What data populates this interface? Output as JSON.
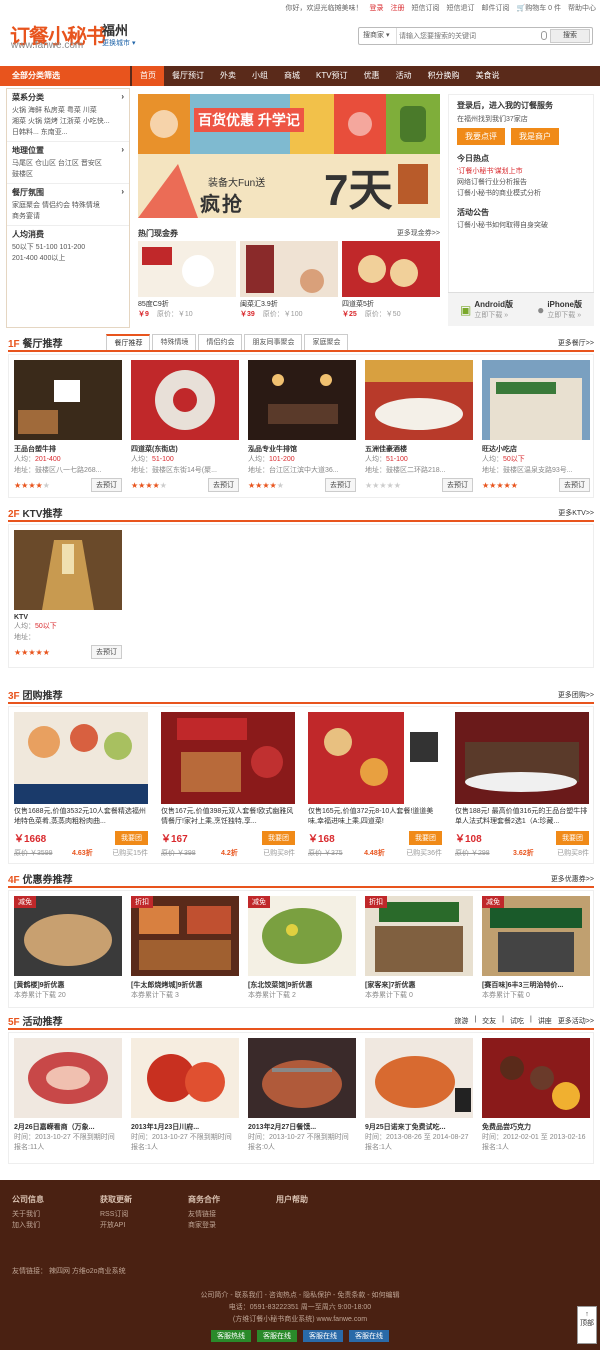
{
  "topbar": {
    "greeting": "你好，欢迎光临摊美味！",
    "login": "登录",
    "register": "注册",
    "links": [
      "短信订阅",
      "短信退订",
      "邮件订阅"
    ],
    "cart": "购物车 0 件",
    "help": "帮助中心"
  },
  "header": {
    "logo": "订餐小秘书",
    "logo_url": "www.fanwe.com",
    "city": "福州",
    "city_switch": "更换城市",
    "search_type": "搜商家",
    "search_placeholder": "请输入您要搜索的关键词",
    "search_button": "搜索"
  },
  "nav": {
    "all_categories": "全部分类筛选",
    "items": [
      "首页",
      "餐厅预订",
      "外卖",
      "小组",
      "商城",
      "KTV预订",
      "优惠",
      "活动",
      "积分换购",
      "美食说"
    ]
  },
  "sidebar": {
    "sections": [
      {
        "title": "菜系分类",
        "links": "201-400"
      },
      {
        "title": "地理位置"
      },
      {
        "title": "餐厅氛围"
      },
      {
        "title": "人均消费"
      }
    ],
    "cuisine": [
      "火锅",
      "海鲜",
      "私房菜",
      "粤菜",
      "川菜",
      "湘菜",
      "火锅",
      "烧烤",
      "江浙菜",
      "小吃快...",
      "日韩料...",
      "东南亚..."
    ],
    "location": [
      "马尾区",
      "仓山区",
      "台江区",
      "晋安区",
      "鼓楼区"
    ],
    "ambience": [
      "家庭聚会",
      "情侣约会",
      "特殊情境",
      "商务宴请"
    ],
    "price": [
      "50以下",
      "51-100",
      "101-200",
      "201-400",
      "400以上"
    ]
  },
  "banner": {
    "title": "百货优惠 升学记",
    "line1": "装备大Fun送",
    "line2": "疯抢",
    "seven": "7天"
  },
  "coupons": {
    "title": "热门现金券",
    "more": "更多现金券>>",
    "items": [
      {
        "name": "85度C9折",
        "price": "￥9",
        "orig": "原价：￥10"
      },
      {
        "name": "闽菜汇3.9折",
        "price": "￥39",
        "orig": "原价：￥100"
      },
      {
        "name": "四道菜5折",
        "price": "￥25",
        "orig": "原价：￥50"
      }
    ]
  },
  "right": {
    "login_title": "登录后，进入我的订餐服务",
    "sub": "在福州找到我们37家店",
    "btn1": "我要点评",
    "btn2": "我是商户",
    "hot_title": "今日热点",
    "hot": [
      "'订餐小秘书'谋划上市",
      "网络订餐行业分析报告",
      "订餐小秘书的商业模式分析"
    ],
    "notice_title": "活动公告",
    "notice": [
      "订餐小秘书如何取得自身突破"
    ],
    "android": "Android版",
    "android_sub": "立即下载 »",
    "iphone": "iPhone版",
    "iphone_sub": "立即下载 »"
  },
  "f1": {
    "num": "1F",
    "title": "餐厅推荐",
    "tabs": [
      "餐厅推荐",
      "特殊情境",
      "情侣约会",
      "朋友同事聚会",
      "家庭聚会"
    ],
    "more": "更多餐厅>>",
    "cards": [
      {
        "name": "王品台塑牛排",
        "people": "201-400",
        "addr": "地址：鼓楼区八一七路268...",
        "stars": 4
      },
      {
        "name": "四道菜(东街店)",
        "people": "51-100",
        "addr": "地址：鼓楼区东街14号(聚...",
        "stars": 4
      },
      {
        "name": "泓品专业牛排馆",
        "people": "101-200",
        "addr": "地址：台江区江滨中大道36...",
        "stars": 4
      },
      {
        "name": "五洲佳豪酒楼",
        "people": "51-100",
        "addr": "地址：鼓楼区二环路218...",
        "stars": 0
      },
      {
        "name": "旺达小吃店",
        "people": "50以下",
        "addr": "地址：鼓楼区温泉支路93号...",
        "stars": 5
      }
    ],
    "people_label": "人均：",
    "btn": "去预订"
  },
  "f2": {
    "num": "2F",
    "title": "KTV推荐",
    "more": "更多KTV>>",
    "card": {
      "name": "KTV",
      "people": "50以下",
      "addr": "地址：",
      "stars": 5
    }
  },
  "f3": {
    "num": "3F",
    "title": "团购推荐",
    "more": "更多团购>>",
    "btn": "我要团",
    "cards": [
      {
        "desc": "仅售1688元,价值3532元10人套餐精选福州地特色菜肴,蒸蒸肉粗粉肉曲...",
        "price": "￥1668",
        "orig": "原价 ￥3599",
        "discount": "4.63折",
        "sold": "已购买15件"
      },
      {
        "desc": "仅售167元,价值398元双人套餐!欧式幽雅风情餐厅!家衬上乘,烹饪独特,享...",
        "price": "￥167",
        "orig": "原价 ￥398",
        "discount": "4.2折",
        "sold": "已购买8件"
      },
      {
        "desc": "仅售165元,价值372元8-10人套餐!道道美味,幸福进味上乘,四道菜!",
        "price": "￥168",
        "orig": "原价 ￥375",
        "discount": "4.48折",
        "sold": "已购买36件"
      },
      {
        "desc": "仅售188元! 最高价值316元的王品台塑牛排单人法式料理套餐2选1（A:珍藏...",
        "price": "￥108",
        "orig": "原价 ￥298",
        "discount": "3.62折",
        "sold": "已购买8件"
      }
    ]
  },
  "f4": {
    "num": "4F",
    "title": "优惠券推荐",
    "more": "更多优惠券>>",
    "cards": [
      {
        "tag": "减免",
        "name": "[黄鹤楼]9折优惠",
        "count": "本券累计下载 20"
      },
      {
        "tag": "折扣",
        "name": "[牛太郎烧烤城]9折优惠",
        "count": "本券累计下载 3"
      },
      {
        "tag": "减免",
        "name": "[东北饺菜馆]9折优惠",
        "count": "本券累计下载 2"
      },
      {
        "tag": "折扣",
        "name": "[家客来]7折优惠",
        "count": "本券累计下载 0"
      },
      {
        "tag": "减免",
        "name": "[赛百味]6丰3三明治特价...",
        "count": "本券累计下载 0"
      }
    ]
  },
  "f5": {
    "num": "5F",
    "title": "活动推荐",
    "sublinks": [
      "旅游",
      "交友",
      "试吃",
      "讲座"
    ],
    "more": "更多活动>>",
    "cards": [
      {
        "name": "2月26日嘉嵘看商（万象...",
        "time": "时间：2013-10-27 不限到期时间",
        "count": "报名:11人"
      },
      {
        "name": "2013年1月23日川府...",
        "time": "时间：2013-10-27 不限到期时间",
        "count": "报名:1人"
      },
      {
        "name": "2013年2月27日餐馍...",
        "time": "时间：2013-10-27 不限到期时间",
        "count": "报名:0人"
      },
      {
        "name": "9月25日诺来丁免费试吃...",
        "time": "时间：2013-08-26 至 2014-08-27",
        "count": "报名:1人"
      },
      {
        "name": "免费品尝巧克力",
        "time": "时间：2012-02-01 至 2013-02-16",
        "count": "报名:1人"
      }
    ]
  },
  "footer": {
    "cols": [
      {
        "title": "公司信息",
        "links": [
          "关于我们",
          "加入我们"
        ]
      },
      {
        "title": "获取更新",
        "links": [
          "RSS订阅",
          "开放API"
        ]
      },
      {
        "title": "商务合作",
        "links": [
          "友情链接",
          "商家登录"
        ]
      },
      {
        "title": "用户帮助",
        "links": []
      }
    ],
    "flink": "友情链接：  辣四网   方维o2o商业系统",
    "nav": "公司简介  -  联系我们  -  咨询热点  -  隐私保护  -  免责条款  -  如何编辑",
    "tel": "电话：0591-83222351 周一至周六 9:00-18:00",
    "copy": "(方维订餐小秘书商业系统) www.fanwe.com",
    "badges": [
      "客服热线",
      "客服在线",
      "客服在线",
      "客服在线"
    ],
    "totop": "顶部"
  },
  "colors": {
    "accent": "#e8541d",
    "nav_bg": "#5a2a1a",
    "footer_bg": "#4a2112",
    "price_red": "#d9292d"
  }
}
